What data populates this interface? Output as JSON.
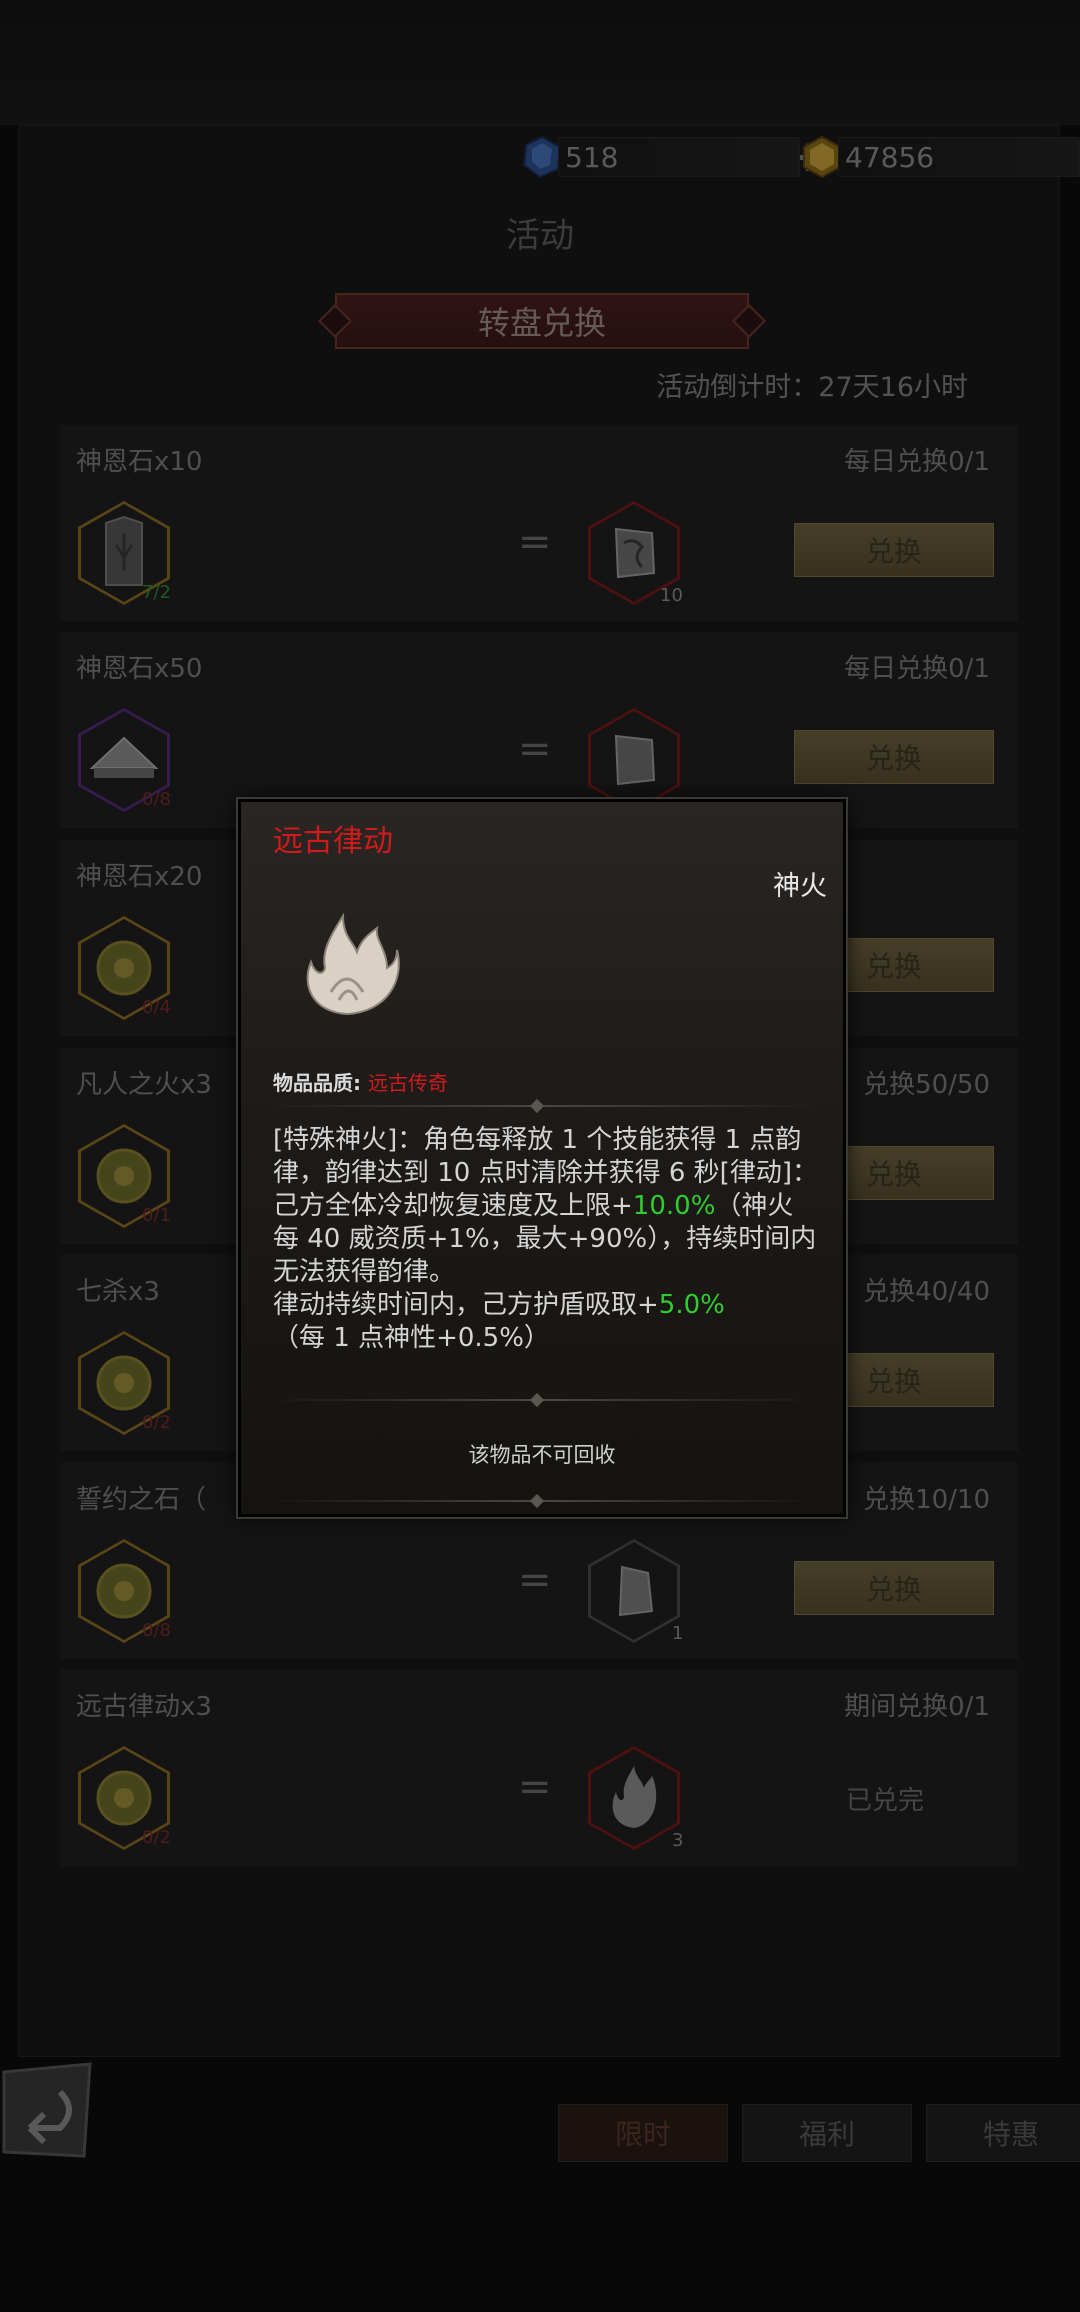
{
  "currency": {
    "gem_value": "518",
    "gold_value": "47856"
  },
  "page_title": "活动",
  "tab_header": "转盘兑换",
  "countdown": "活动倒计时：27天16小时",
  "rows": [
    {
      "name": "神恩石x10",
      "limit": "每日兑换0/1",
      "cost_count": "7/2",
      "reward_count": "10",
      "button": "兑换"
    },
    {
      "name": "神恩石x50",
      "limit": "每日兑换0/1",
      "cost_count": "0/8",
      "reward_count": "",
      "button": "兑换"
    },
    {
      "name": "神恩石x20",
      "limit": "",
      "cost_count": "0/4",
      "reward_count": "",
      "button": "兑换"
    },
    {
      "name": "凡人之火x3",
      "limit": "兑换50/50",
      "cost_count": "0/1",
      "reward_count": "",
      "button": "兑换"
    },
    {
      "name": "七杀x3",
      "limit": "兑换40/40",
      "cost_count": "0/2",
      "reward_count": "",
      "button": "兑换"
    },
    {
      "name": "誓约之石（",
      "limit": "兑换10/10",
      "cost_count": "0/8",
      "reward_count": "1",
      "button": "兑换"
    },
    {
      "name": "远古律动x3",
      "limit": "期间兑换0/1",
      "cost_count": "0/2",
      "reward_count": "3",
      "button": "已兑完"
    }
  ],
  "bottom_tabs": [
    "限时",
    "福利",
    "特惠"
  ],
  "popup": {
    "title": "远古律动",
    "type": "神火",
    "quality_label": "物品品质:",
    "quality_value": "远古传奇",
    "desc_1": "[特殊神火]：角色每释放 1 个技能获得 1 点韵律，韵律达到 10 点时清除并获得 6 秒[律动]：己方全体冷却恢复速度及上限+",
    "desc_green_1": "10.0%",
    "desc_2": "（神火每 40 威资质+1%，最大+90%），持续时间内无法获得韵律。",
    "desc_3": "律动持续时间内，己方护盾吸取+",
    "desc_green_2": "5.0%",
    "desc_4": "（每 1 点神性+0.5%）",
    "footer": "该物品不可回收"
  },
  "colors": {
    "accent_red": "#d11a1a",
    "accent_green": "#2fce2f",
    "button_gold": "#6a5f3e"
  }
}
